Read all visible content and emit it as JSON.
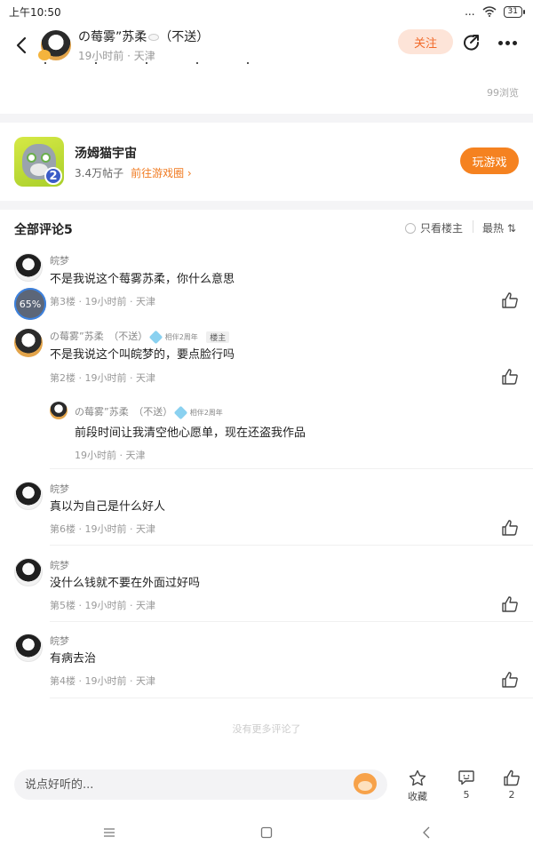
{
  "status_bar": {
    "time": "上午10:50",
    "signal": "...",
    "battery": "31"
  },
  "header": {
    "author_name": "の莓雾”苏柔",
    "author_suffix": "（不送）",
    "author_meta": "19小时前 · 天津",
    "follow_label": "关注"
  },
  "post": {
    "views": "99浏览"
  },
  "game": {
    "title": "汤姆猫宇宙",
    "posts": "3.4万帖子",
    "link": "前往游戏圈 ›",
    "badge": "2",
    "play_label": "玩游戏"
  },
  "comments_header": {
    "title": "全部评论5",
    "only_host": "只看楼主",
    "sort": "最热 ⇅"
  },
  "progress_badge": "65%",
  "comments": [
    {
      "name": "皖梦",
      "text": "不是我说这个莓雾苏柔，你什么意思",
      "meta": "第3楼 · 19小时前 · 天津"
    },
    {
      "name": "の莓雾”苏柔　（不送）",
      "tag": "相伴2周年",
      "host_tag": "楼主",
      "text": "不是我说这个叫皖梦的，要点脸行吗",
      "meta": "第2楼 · 19小时前 · 天津"
    },
    {
      "name": "の莓雾”苏柔　（不送）",
      "tag": "相伴2周年",
      "text": "前段时间让我清空他心愿单，现在还盗我作品",
      "meta": "19小时前 · 天津"
    },
    {
      "name": "皖梦",
      "text": "真以为自己是什么好人",
      "meta": "第6楼 · 19小时前 · 天津"
    },
    {
      "name": "皖梦",
      "text": "没什么钱就不要在外面过好吗",
      "meta": "第5楼 · 19小时前 · 天津"
    },
    {
      "name": "皖梦",
      "text": "有病去治",
      "meta": "第4楼 · 19小时前 · 天津"
    }
  ],
  "no_more": "没有更多评论了",
  "bottom_bar": {
    "input_placeholder": "说点好听的...",
    "favorite_label": "收藏",
    "comment_count": "5",
    "like_count": "2"
  }
}
